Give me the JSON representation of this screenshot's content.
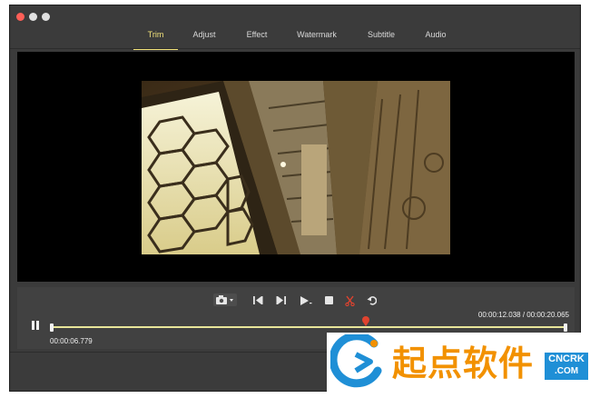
{
  "window": {
    "controls": [
      {
        "name": "close-button",
        "color": "#ff5f57"
      },
      {
        "name": "minimize-button",
        "color": "#e0e0e0"
      },
      {
        "name": "zoom-button",
        "color": "#e0e0e0"
      }
    ]
  },
  "tabs": [
    {
      "label": "Trim",
      "active": true
    },
    {
      "label": "Adjust",
      "active": false
    },
    {
      "label": "Effect",
      "active": false
    },
    {
      "label": "Watermark",
      "active": false
    },
    {
      "label": "Subtitle",
      "active": false
    },
    {
      "label": "Audio",
      "active": false
    }
  ],
  "player": {
    "current_time": "00:00:06.779",
    "range_time": "00:00:12.038 / 00:00:20.065",
    "playhead_fraction": 0.61
  },
  "toolbar_icons": [
    "snapshot-camera-icon",
    "previous-frame-icon",
    "next-frame-icon",
    "play-segment-icon",
    "stop-icon",
    "cut-scissors-icon",
    "undo-icon"
  ],
  "watermark_logo": {
    "text": "起点软件",
    "badge_top": "CNCRK",
    "badge_bottom": ".COM",
    "accent": "#f29100",
    "blue": "#1f8fd6"
  }
}
